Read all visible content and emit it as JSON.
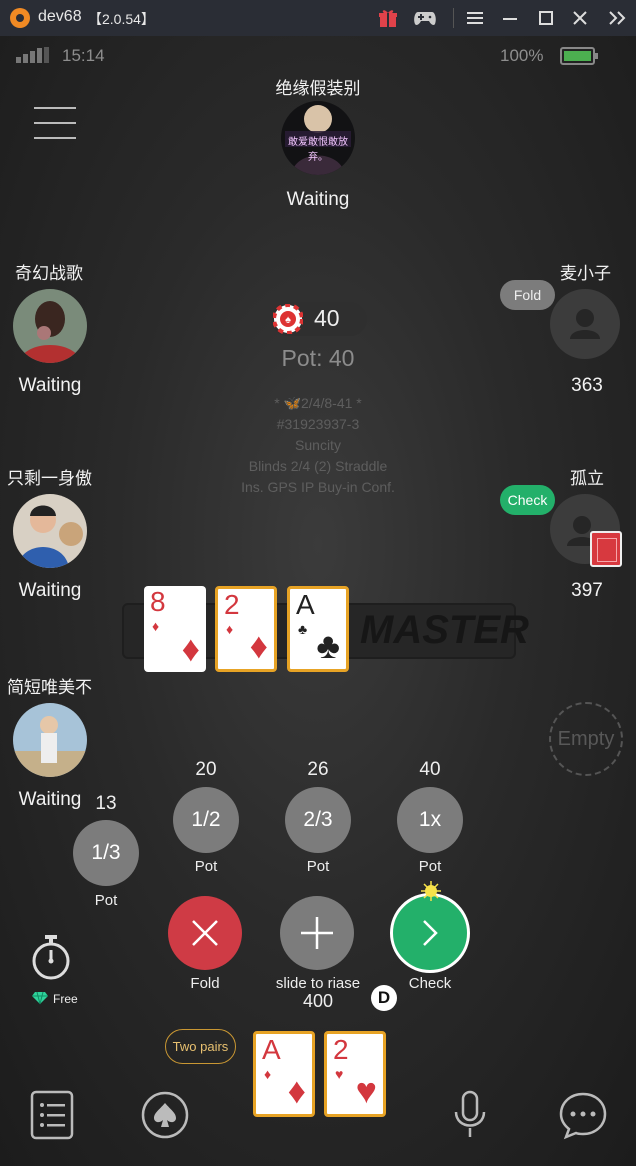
{
  "emulator": {
    "app_name": "dev68",
    "version": "【2.0.54】"
  },
  "status_bar": {
    "time": "15:14",
    "battery": "100%"
  },
  "players": {
    "top": {
      "name": "绝缘假装别",
      "avatar_text": "敢爱敢恨敢放弃。",
      "status": "Waiting"
    },
    "left1": {
      "name": "奇幻战歌",
      "status": "Waiting"
    },
    "left2": {
      "name": "只剩一身傲",
      "status": "Waiting"
    },
    "left3": {
      "name": "简短唯美不",
      "status": "Waiting"
    },
    "right1": {
      "name": "麦小子",
      "action": "Fold",
      "chips": "363"
    },
    "right2": {
      "name": "孤立",
      "action": "Check",
      "chips": "397"
    },
    "right3": {
      "label": "Empty"
    }
  },
  "pot": {
    "chip_amount": "40",
    "label": "Pot: 40"
  },
  "table_info": {
    "line1": "* 🦋2/4/8-41 *",
    "line2": "#31923937-3",
    "line3": "Suncity",
    "line4": "Blinds 2/4 (2) Straddle",
    "line5": "Ins. GPS IP Buy-in Conf."
  },
  "watermark": "MASTER",
  "community_cards": [
    {
      "rank": "8",
      "suit": "♦",
      "color": "red",
      "highlighted": false
    },
    {
      "rank": "2",
      "suit": "♦",
      "color": "red",
      "highlighted": true
    },
    {
      "rank": "A",
      "suit": "♣",
      "color": "black",
      "highlighted": true
    }
  ],
  "bet_options": [
    {
      "amount": "13",
      "label": "1/3",
      "sub": "Pot"
    },
    {
      "amount": "20",
      "label": "1/2",
      "sub": "Pot"
    },
    {
      "amount": "26",
      "label": "2/3",
      "sub": "Pot"
    },
    {
      "amount": "40",
      "label": "1x",
      "sub": "Pot"
    }
  ],
  "actions": {
    "fold": "Fold",
    "raise": "slide to riase",
    "raise_amount": "400",
    "check": "Check",
    "dealer": "D"
  },
  "timer": {
    "label": "Free"
  },
  "hand": {
    "rank_label": "Two pairs",
    "cards": [
      {
        "rank": "A",
        "suit": "♦",
        "color": "red"
      },
      {
        "rank": "2",
        "suit": "♥",
        "color": "red"
      }
    ]
  },
  "colors": {
    "fold": "#cf3b45",
    "check": "#23b06a",
    "gold": "#e7a325",
    "bet_gray": "#7c7c7c"
  }
}
